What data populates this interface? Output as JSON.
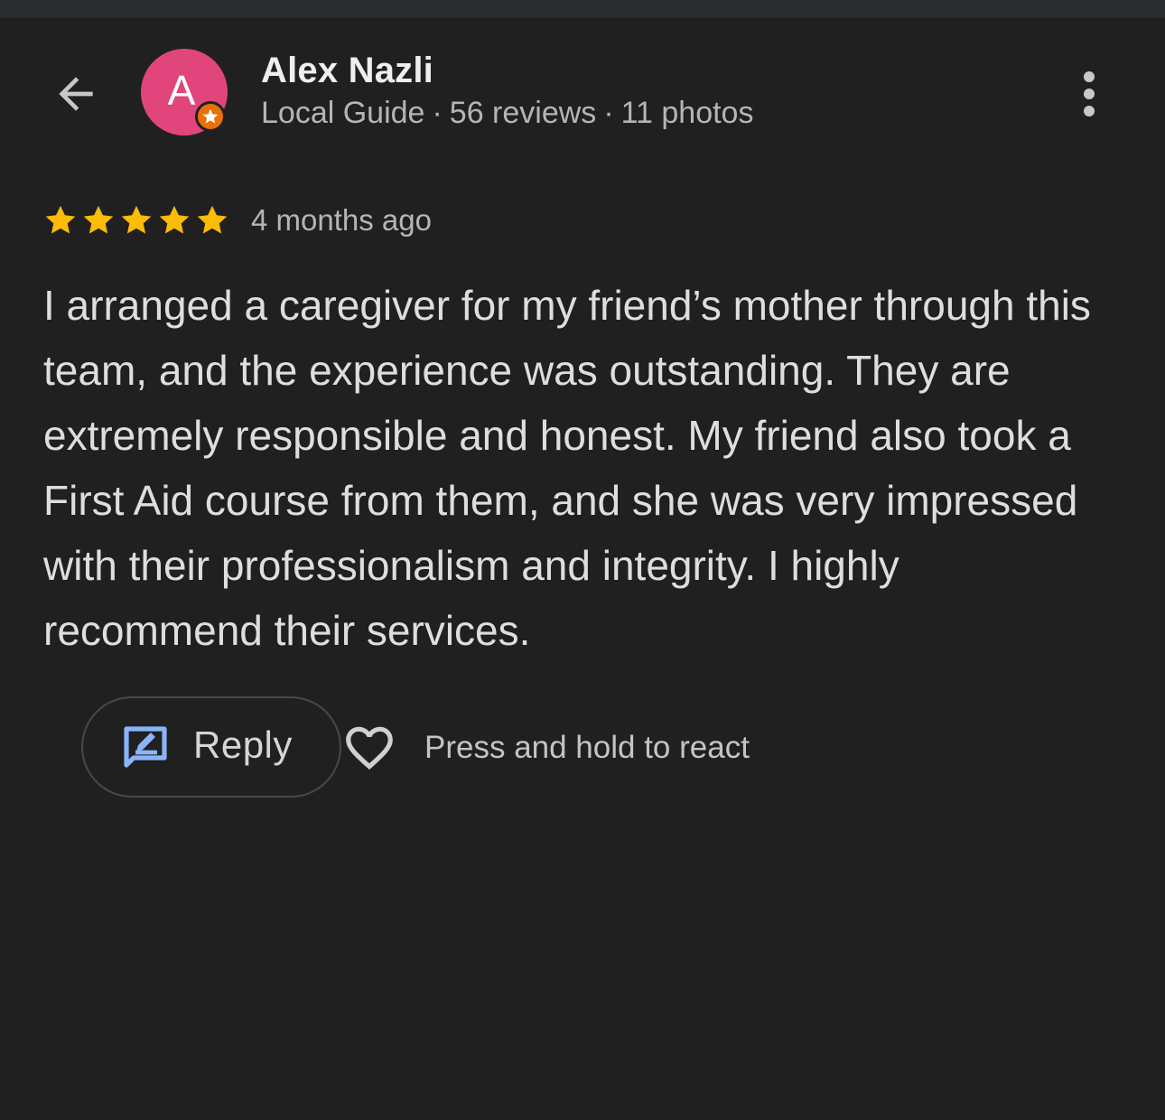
{
  "review": {
    "reviewer": {
      "name": "Alex Nazli",
      "avatar_letter": "A",
      "avatar_color": "#e0467c",
      "badge_icon": "local-guide-star-icon",
      "badge_color": "#e8710a",
      "role": "Local Guide",
      "reviews_count": "56 reviews",
      "photos_count": "11 photos",
      "separator": "·"
    },
    "rating": 5,
    "max_rating": 5,
    "star_color": "#fbbc04",
    "time_ago": "4 months ago",
    "text": "I arranged a caregiver for my friend’s mother through this team, and the experience was outstanding. They are extremely responsible and honest. My friend also took a First Aid course from them, and she was very impressed with their professionalism and integrity. I highly recommend their services."
  },
  "actions": {
    "back_icon": "arrow-left-icon",
    "more_icon": "more-vert-icon",
    "reply_icon": "rate-review-icon",
    "reply_icon_color": "#8ab4f8",
    "reply_label": "Reply",
    "react_icon": "heart-outline-icon",
    "react_hint": "Press and hold to react"
  }
}
